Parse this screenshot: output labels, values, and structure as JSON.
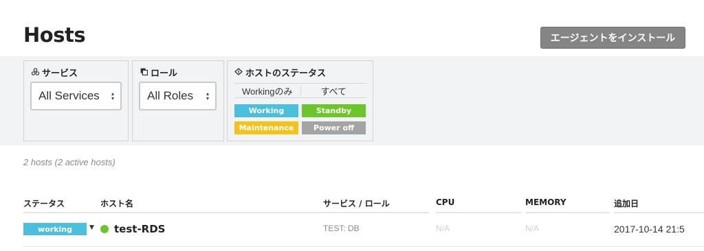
{
  "header": {
    "title": "Hosts",
    "install_button": "エージェントをインストール"
  },
  "filters": {
    "services": {
      "title": "サービス",
      "icon": "services-icon",
      "selected": "All Services"
    },
    "roles": {
      "title": "ロール",
      "icon": "roles-icon",
      "selected": "All Roles"
    },
    "status": {
      "title": "ホストのステータス",
      "icon": "status-icon",
      "toggle_working_only": "Workingのみ",
      "toggle_all": "すべて",
      "chips": [
        {
          "label": "Working",
          "color": "#4bbfde"
        },
        {
          "label": "Standby",
          "color": "#6bc62a"
        },
        {
          "label": "Maintenance",
          "color": "#f4c21a"
        },
        {
          "label": "Power off",
          "color": "#a4a4a4"
        }
      ]
    }
  },
  "summary": "2 hosts (2 active hosts)",
  "table": {
    "columns": [
      "ステータス",
      "ホスト名",
      "サービス / ロール",
      "CPU",
      "MEMORY",
      "追加日"
    ],
    "rows": [
      {
        "status": "working",
        "status_color": "#4bbfde",
        "health_color": "#6bc62a",
        "host_name": "test-RDS",
        "service_role": "TEST: DB",
        "cpu": "N/A",
        "memory": "N/A",
        "added": "2017-10-14 21:5"
      }
    ]
  }
}
